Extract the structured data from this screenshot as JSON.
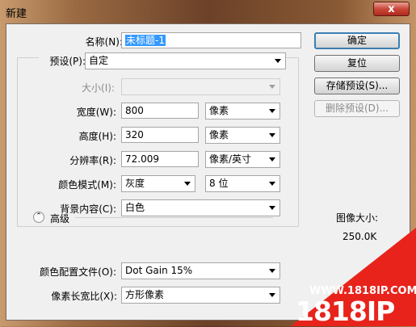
{
  "window": {
    "title": "新建",
    "close_glyph": "x"
  },
  "form": {
    "name": {
      "label": "名称(N):",
      "value": "未标题-1"
    },
    "preset": {
      "label": "预设(P):",
      "value": "自定"
    },
    "size": {
      "label": "大小(I):",
      "value": ""
    },
    "width": {
      "label": "宽度(W):",
      "value": "800",
      "unit": "像素"
    },
    "height": {
      "label": "高度(H):",
      "value": "320",
      "unit": "像素"
    },
    "resolution": {
      "label": "分辨率(R):",
      "value": "72.009",
      "unit": "像素/英寸"
    },
    "color_mode": {
      "label": "颜色模式(M):",
      "value": "灰度",
      "depth": "8 位"
    },
    "background": {
      "label": "背景内容(C):",
      "value": "白色"
    },
    "advanced": {
      "label": "高级",
      "icon": "collapse-up-icon"
    },
    "color_profile": {
      "label": "颜色配置文件(O):",
      "value": "Dot Gain 15%"
    },
    "pixel_aspect": {
      "label": "像素长宽比(X):",
      "value": "方形像素"
    }
  },
  "buttons": {
    "ok": "确定",
    "reset": "复位",
    "save_preset": "存储预设(S)...",
    "delete_preset": "删除预设(D)..."
  },
  "image_size": {
    "label": "图像大小:",
    "value": "250.0K"
  },
  "watermark": {
    "url": "WWW.1818IP.COM",
    "logo": "1818IP"
  }
}
